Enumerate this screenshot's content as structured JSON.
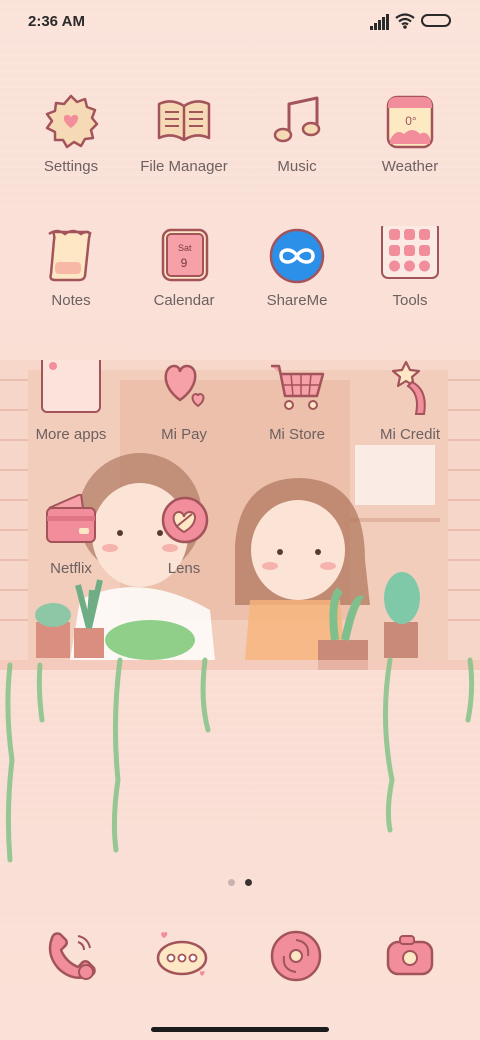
{
  "status_bar": {
    "time": "2:36 AM",
    "icons": [
      "signal-icon",
      "wifi-icon",
      "battery-icon"
    ]
  },
  "home": {
    "rows": [
      [
        {
          "label": "Settings",
          "icon": "settings-icon"
        },
        {
          "label": "File Manager",
          "icon": "file-manager-icon"
        },
        {
          "label": "Music",
          "icon": "music-icon"
        },
        {
          "label": "Weather",
          "icon": "weather-icon",
          "icon_text": "0°"
        }
      ],
      [
        {
          "label": "Notes",
          "icon": "notes-icon"
        },
        {
          "label": "Calendar",
          "icon": "calendar-icon",
          "icon_text": "Sat",
          "icon_text2": "9"
        },
        {
          "label": "ShareMe",
          "icon": "shareme-icon"
        },
        {
          "label": "Tools",
          "icon": "tools-folder-icon"
        }
      ],
      [
        {
          "label": "More apps",
          "icon": "more-apps-folder-icon"
        },
        {
          "label": "Mi Pay",
          "icon": "mi-pay-icon"
        },
        {
          "label": "Mi Store",
          "icon": "mi-store-icon"
        },
        {
          "label": "Mi Credit",
          "icon": "mi-credit-icon"
        }
      ],
      [
        {
          "label": "Netflix",
          "icon": "netflix-icon"
        },
        {
          "label": "Lens",
          "icon": "lens-icon"
        }
      ]
    ]
  },
  "page_indicator": {
    "pages": 2,
    "current": 2
  },
  "dock": [
    {
      "icon": "phone-icon"
    },
    {
      "icon": "messages-icon"
    },
    {
      "icon": "browser-icon"
    },
    {
      "icon": "camera-icon"
    }
  ],
  "colors": {
    "background": "#fbe1d8",
    "icon_stroke": "#a3545a",
    "icon_fill": "#f5a3a9",
    "label": "#6d6060",
    "shareme_blue": "#2c8fe8"
  }
}
